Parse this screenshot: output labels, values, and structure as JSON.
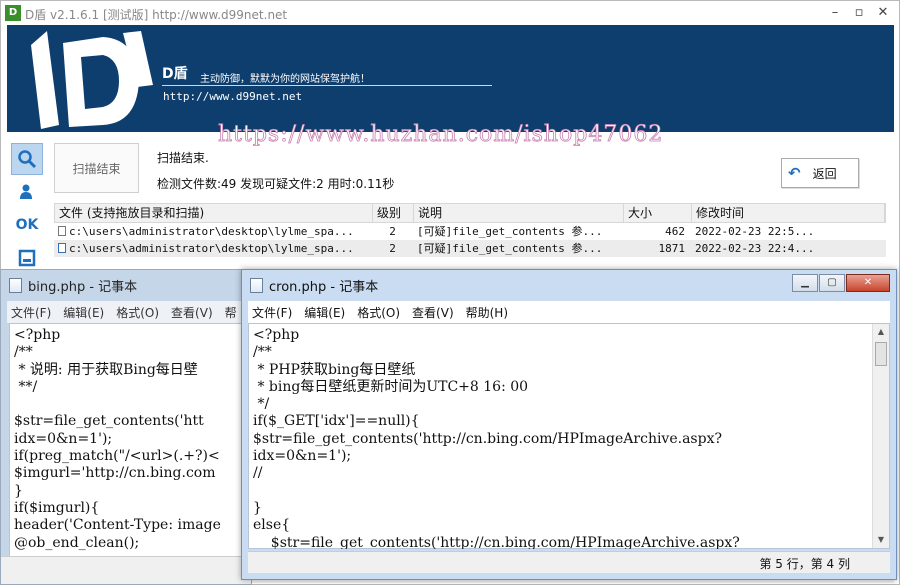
{
  "dshield": {
    "title": "D盾 v2.1.6.1 [测试版] http://www.d99net.net",
    "logo_small": "D",
    "brand": "D盾",
    "slogan": "主动防御，默默为你的网站保驾护航！",
    "url": "http://www.d99net.net",
    "watermark": "https://www.huzhan.com/ishop47062",
    "sidebar": [
      {
        "icon": "search-icon",
        "label": ""
      },
      {
        "icon": "user-shield-icon",
        "label": ""
      },
      {
        "icon": "ok-icon",
        "label": "OK"
      },
      {
        "icon": "window-icon",
        "label": ""
      }
    ],
    "scan_button": "扫描结束",
    "status_line1": "扫描结束.",
    "status_line2": "检测文件数:49 发现可疑文件:2 用时:0.11秒",
    "back_button": "返回",
    "table": {
      "headers": [
        "文件 (支持拖放目录和扫描)",
        "级别",
        "说明",
        "大小",
        "修改时间"
      ],
      "rows": [
        {
          "file": "c:\\users\\administrator\\desktop\\lylme_spa...",
          "level": "2",
          "desc": "[可疑]file_get_contents 参...",
          "size": "462",
          "time": "2022-02-23 22:5..."
        },
        {
          "file": "c:\\users\\administrator\\desktop\\lylme_spa...",
          "level": "2",
          "desc": "[可疑]file_get_contents 参...",
          "size": "1871",
          "time": "2022-02-23 22:4..."
        }
      ]
    },
    "colors": {
      "banner": "#0e3e6e",
      "accent": "#1e6fbf"
    }
  },
  "notepad1": {
    "title": "bing.php - 记事本",
    "menu": [
      "文件(F)",
      "编辑(E)",
      "格式(O)",
      "查看(V)",
      "帮"
    ],
    "content": "<?php\n/**\n * 说明: 用于获取Bing每日壁\n **/\n\n$str=file_get_contents('htt\nidx=0&n=1');\nif(preg_match(\"/<url>(.+?)<\n$imgurl='http://cn.bing.com\n}\nif($imgurl){\nheader('Content-Type: image\n@ob_end_clean();"
  },
  "notepad2": {
    "title": "cron.php - 记事本",
    "menu": [
      "文件(F)",
      "编辑(E)",
      "格式(O)",
      "查看(V)",
      "帮助(H)"
    ],
    "content": "<?php\n/**\n * PHP获取bing每日壁纸\n * bing每日壁纸更新时间为UTC+8 16: 00\n */\nif($_GET['idx']==null){\n$str=file_get_contents('http://cn.bing.com/HPImageArchive.aspx?\nidx=0&n=1');\n//\n\n}\nelse{\n    $str=file_get_contents('http://cn.bing.com/HPImageArchive.aspx?",
    "status": "第 5 行，第 4 列"
  }
}
